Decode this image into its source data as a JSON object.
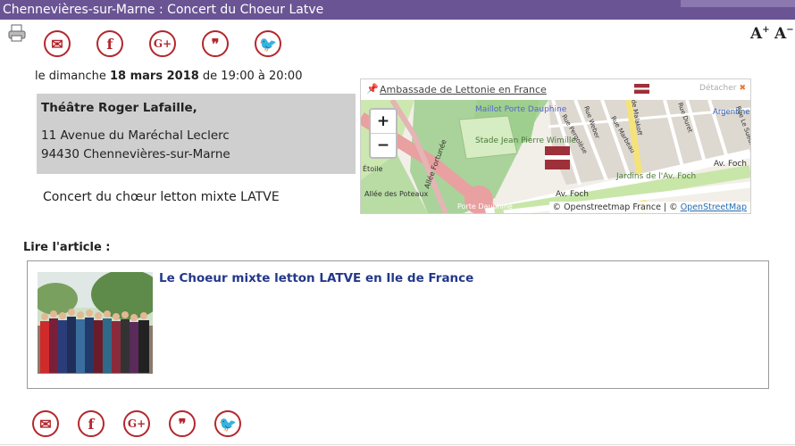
{
  "window": {
    "title": "Chennevières-sur-Marne : Concert du Choeur Latve"
  },
  "share_top": [
    {
      "name": "email-share-icon",
      "glyph": "✉"
    },
    {
      "name": "facebook-share-icon",
      "glyph": "f"
    },
    {
      "name": "googleplus-share-icon",
      "glyph": "G+"
    },
    {
      "name": "quote-share-icon",
      "glyph": "❞"
    },
    {
      "name": "twitter-share-icon",
      "glyph": "🐦"
    }
  ],
  "font_controls": {
    "increase": "A",
    "decrease": "A"
  },
  "event": {
    "date_prefix": "le dimanche ",
    "date": "18 mars 2018",
    "time": " de 19:00 à 20:00",
    "venue_name": "Théâtre Roger Lafaille,",
    "address_line1": "11 Avenue du Maréchal Leclerc",
    "address_line2": "94430 Chennevières-sur-Marne",
    "description": "Concert du chœur letton mixte LATVE"
  },
  "map": {
    "place_link": "Ambassade de Lettonie en France",
    "detach_label": "Détacher",
    "zoom_in": "+",
    "zoom_out": "−",
    "attribution_prefix": "© Openstreetmap France | © ",
    "attribution_link": "OpenStreetMap",
    "street_labels": [
      "Av. Foch",
      "Av. Foch",
      "Jardins de l'Av. Foch",
      "Stade Jean Pierre Wimille",
      "Maillot Porte Dauphine",
      "Allée des Poteaux",
      "Allée Fortunée",
      "Argentine",
      "Étoile",
      "Porte Dauphine",
      "Rue Le Sueur",
      "Rue Duret",
      "Rue Pergolèse",
      "Rue Weber",
      "Rue Marbeau",
      "de Malakoff"
    ],
    "flag_colors": [
      "#9e3039",
      "#ffffff",
      "#9e3039"
    ]
  },
  "read_article": {
    "heading": "Lire l'article :",
    "title": "Le Choeur mixte letton LATVE en Ile de France"
  },
  "colors": {
    "titlebar": "#6a5494",
    "share_accent": "#b2282e",
    "link_blue": "#23388a"
  }
}
